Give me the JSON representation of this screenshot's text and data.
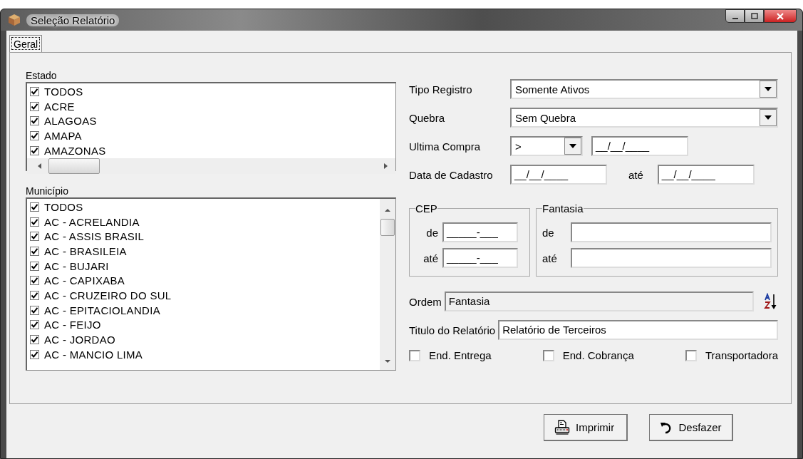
{
  "window": {
    "title": "Seleção Relatório"
  },
  "tabs": [
    {
      "label": "Geral",
      "selected": true
    }
  ],
  "estado": {
    "label": "Estado",
    "items": [
      {
        "label": "TODOS",
        "checked": true
      },
      {
        "label": "ACRE",
        "checked": true
      },
      {
        "label": "ALAGOAS",
        "checked": true
      },
      {
        "label": "AMAPA",
        "checked": true
      },
      {
        "label": "AMAZONAS",
        "checked": true
      }
    ]
  },
  "municipio": {
    "label": "Município",
    "items": [
      {
        "label": "TODOS",
        "checked": true
      },
      {
        "label": "AC - ACRELANDIA",
        "checked": true
      },
      {
        "label": "AC - ASSIS BRASIL",
        "checked": true
      },
      {
        "label": "AC - BRASILEIA",
        "checked": true
      },
      {
        "label": "AC - BUJARI",
        "checked": true
      },
      {
        "label": "AC - CAPIXABA",
        "checked": true
      },
      {
        "label": "AC - CRUZEIRO DO SUL",
        "checked": true
      },
      {
        "label": "AC - EPITACIOLANDIA",
        "checked": true
      },
      {
        "label": "AC - FEIJO",
        "checked": true
      },
      {
        "label": "AC - JORDAO",
        "checked": true
      },
      {
        "label": "AC - MANCIO LIMA",
        "checked": true
      }
    ]
  },
  "tipo_registro": {
    "label": "Tipo Registro",
    "value": "Somente Ativos"
  },
  "quebra": {
    "label": "Quebra",
    "value": "Sem Quebra"
  },
  "ultima_compra": {
    "label": "Ultima Compra",
    "operator": ">",
    "date": "__/__/____"
  },
  "data_cadastro": {
    "label": "Data de Cadastro",
    "from": "__/__/____",
    "to_label": "até",
    "to": "__/__/____"
  },
  "cep": {
    "title": "CEP",
    "from_label": "de",
    "from": "_____-___",
    "to_label": "até",
    "to": "_____-___"
  },
  "fantasia": {
    "title": "Fantasia",
    "from_label": "de",
    "to_label": "até"
  },
  "ordem": {
    "label": "Ordem",
    "value": "Fantasia"
  },
  "titulo": {
    "label": "Titulo do Relatório",
    "value": "Relatório de Terceiros"
  },
  "options": [
    {
      "label": "End. Entrega",
      "checked": false
    },
    {
      "label": "End. Cobrança",
      "checked": false
    },
    {
      "label": "Transportadora",
      "checked": false
    }
  ],
  "buttons": [
    {
      "label": "Imprimir",
      "kind": "print"
    },
    {
      "label": "Desfazer",
      "kind": "undo"
    }
  ]
}
